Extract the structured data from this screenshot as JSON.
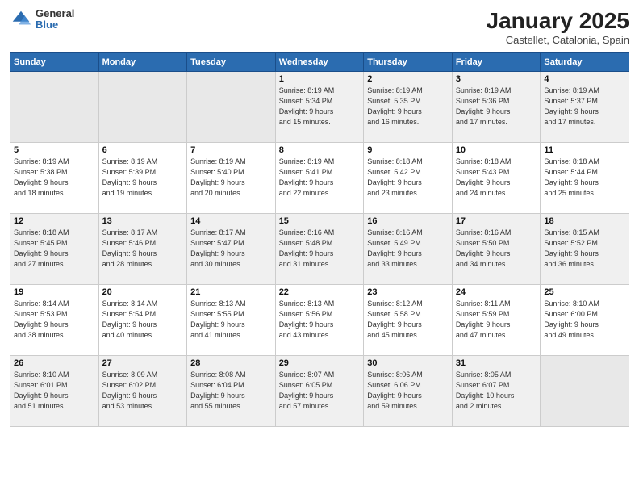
{
  "logo": {
    "general": "General",
    "blue": "Blue"
  },
  "header": {
    "month": "January 2025",
    "location": "Castellet, Catalonia, Spain"
  },
  "weekdays": [
    "Sunday",
    "Monday",
    "Tuesday",
    "Wednesday",
    "Thursday",
    "Friday",
    "Saturday"
  ],
  "weeks": [
    [
      {
        "day": "",
        "info": ""
      },
      {
        "day": "",
        "info": ""
      },
      {
        "day": "",
        "info": ""
      },
      {
        "day": "1",
        "info": "Sunrise: 8:19 AM\nSunset: 5:34 PM\nDaylight: 9 hours\nand 15 minutes."
      },
      {
        "day": "2",
        "info": "Sunrise: 8:19 AM\nSunset: 5:35 PM\nDaylight: 9 hours\nand 16 minutes."
      },
      {
        "day": "3",
        "info": "Sunrise: 8:19 AM\nSunset: 5:36 PM\nDaylight: 9 hours\nand 17 minutes."
      },
      {
        "day": "4",
        "info": "Sunrise: 8:19 AM\nSunset: 5:37 PM\nDaylight: 9 hours\nand 17 minutes."
      }
    ],
    [
      {
        "day": "5",
        "info": "Sunrise: 8:19 AM\nSunset: 5:38 PM\nDaylight: 9 hours\nand 18 minutes."
      },
      {
        "day": "6",
        "info": "Sunrise: 8:19 AM\nSunset: 5:39 PM\nDaylight: 9 hours\nand 19 minutes."
      },
      {
        "day": "7",
        "info": "Sunrise: 8:19 AM\nSunset: 5:40 PM\nDaylight: 9 hours\nand 20 minutes."
      },
      {
        "day": "8",
        "info": "Sunrise: 8:19 AM\nSunset: 5:41 PM\nDaylight: 9 hours\nand 22 minutes."
      },
      {
        "day": "9",
        "info": "Sunrise: 8:18 AM\nSunset: 5:42 PM\nDaylight: 9 hours\nand 23 minutes."
      },
      {
        "day": "10",
        "info": "Sunrise: 8:18 AM\nSunset: 5:43 PM\nDaylight: 9 hours\nand 24 minutes."
      },
      {
        "day": "11",
        "info": "Sunrise: 8:18 AM\nSunset: 5:44 PM\nDaylight: 9 hours\nand 25 minutes."
      }
    ],
    [
      {
        "day": "12",
        "info": "Sunrise: 8:18 AM\nSunset: 5:45 PM\nDaylight: 9 hours\nand 27 minutes."
      },
      {
        "day": "13",
        "info": "Sunrise: 8:17 AM\nSunset: 5:46 PM\nDaylight: 9 hours\nand 28 minutes."
      },
      {
        "day": "14",
        "info": "Sunrise: 8:17 AM\nSunset: 5:47 PM\nDaylight: 9 hours\nand 30 minutes."
      },
      {
        "day": "15",
        "info": "Sunrise: 8:16 AM\nSunset: 5:48 PM\nDaylight: 9 hours\nand 31 minutes."
      },
      {
        "day": "16",
        "info": "Sunrise: 8:16 AM\nSunset: 5:49 PM\nDaylight: 9 hours\nand 33 minutes."
      },
      {
        "day": "17",
        "info": "Sunrise: 8:16 AM\nSunset: 5:50 PM\nDaylight: 9 hours\nand 34 minutes."
      },
      {
        "day": "18",
        "info": "Sunrise: 8:15 AM\nSunset: 5:52 PM\nDaylight: 9 hours\nand 36 minutes."
      }
    ],
    [
      {
        "day": "19",
        "info": "Sunrise: 8:14 AM\nSunset: 5:53 PM\nDaylight: 9 hours\nand 38 minutes."
      },
      {
        "day": "20",
        "info": "Sunrise: 8:14 AM\nSunset: 5:54 PM\nDaylight: 9 hours\nand 40 minutes."
      },
      {
        "day": "21",
        "info": "Sunrise: 8:13 AM\nSunset: 5:55 PM\nDaylight: 9 hours\nand 41 minutes."
      },
      {
        "day": "22",
        "info": "Sunrise: 8:13 AM\nSunset: 5:56 PM\nDaylight: 9 hours\nand 43 minutes."
      },
      {
        "day": "23",
        "info": "Sunrise: 8:12 AM\nSunset: 5:58 PM\nDaylight: 9 hours\nand 45 minutes."
      },
      {
        "day": "24",
        "info": "Sunrise: 8:11 AM\nSunset: 5:59 PM\nDaylight: 9 hours\nand 47 minutes."
      },
      {
        "day": "25",
        "info": "Sunrise: 8:10 AM\nSunset: 6:00 PM\nDaylight: 9 hours\nand 49 minutes."
      }
    ],
    [
      {
        "day": "26",
        "info": "Sunrise: 8:10 AM\nSunset: 6:01 PM\nDaylight: 9 hours\nand 51 minutes."
      },
      {
        "day": "27",
        "info": "Sunrise: 8:09 AM\nSunset: 6:02 PM\nDaylight: 9 hours\nand 53 minutes."
      },
      {
        "day": "28",
        "info": "Sunrise: 8:08 AM\nSunset: 6:04 PM\nDaylight: 9 hours\nand 55 minutes."
      },
      {
        "day": "29",
        "info": "Sunrise: 8:07 AM\nSunset: 6:05 PM\nDaylight: 9 hours\nand 57 minutes."
      },
      {
        "day": "30",
        "info": "Sunrise: 8:06 AM\nSunset: 6:06 PM\nDaylight: 9 hours\nand 59 minutes."
      },
      {
        "day": "31",
        "info": "Sunrise: 8:05 AM\nSunset: 6:07 PM\nDaylight: 10 hours\nand 2 minutes."
      },
      {
        "day": "",
        "info": ""
      }
    ]
  ]
}
